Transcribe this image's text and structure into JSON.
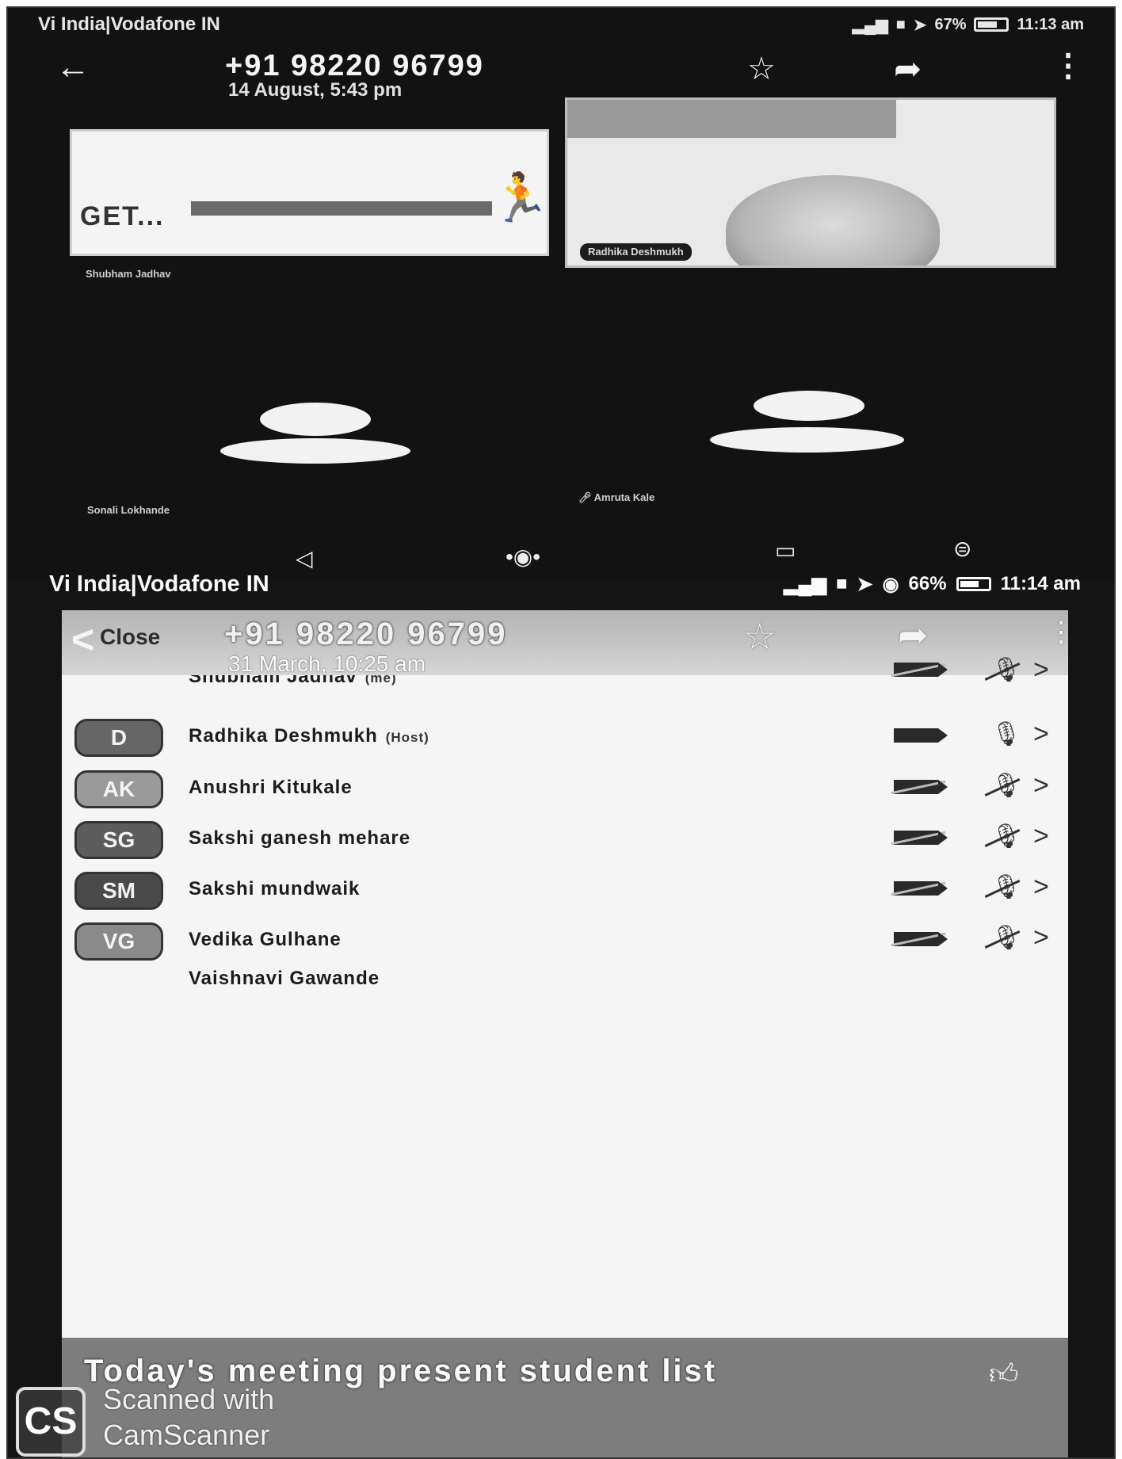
{
  "screen1": {
    "status": {
      "carrier": "Vi India|Vodafone IN",
      "battery": "67%",
      "time": "11:13 am"
    },
    "header": {
      "back_icon": "arrow-left-icon",
      "number": "+91 98220 96799",
      "date": "14 August, 5:43 pm",
      "star_icon": "star-icon",
      "share_icon": "share-arrow-icon",
      "menu_icon": "kebab-menu-icon"
    },
    "tiles": [
      {
        "name": "Shubham Jadhav",
        "content": "GET..."
      },
      {
        "name": "Radhika Deshmukh"
      },
      {
        "name": "Sonali Lokhande"
      },
      {
        "name": "Amruta Kale"
      }
    ]
  },
  "screen2": {
    "status": {
      "carrier": "Vi India|Vodafone IN",
      "battery": "66%",
      "time": "11:14 am"
    },
    "header": {
      "close_label": "Close",
      "number": "+91 98220 96799",
      "date": "31 March, 10:25 am"
    },
    "participants": [
      {
        "initials": "",
        "name": "Shubham Jadhav",
        "tag": "(me)",
        "video_off": true,
        "mic_off": true
      },
      {
        "initials": "D",
        "name": "Radhika Deshmukh",
        "tag": "(Host)",
        "video_off": false,
        "mic_off": false
      },
      {
        "initials": "AK",
        "name": "Anushri Kitukale",
        "tag": "",
        "video_off": true,
        "mic_off": true
      },
      {
        "initials": "SG",
        "name": "Sakshi ganesh mehare",
        "tag": "",
        "video_off": true,
        "mic_off": true
      },
      {
        "initials": "SM",
        "name": "Sakshi mundwaik",
        "tag": "",
        "video_off": true,
        "mic_off": true
      },
      {
        "initials": "VG",
        "name": "Vedika Gulhane",
        "tag": "",
        "video_off": true,
        "mic_off": true
      },
      {
        "initials": "",
        "name": "Vaishnavi Gawande",
        "tag": ""
      }
    ],
    "caption": "Today's meeting present student list"
  },
  "watermark": {
    "logo": "CS",
    "line1": "Scanned with",
    "line2": "CamScanner"
  }
}
